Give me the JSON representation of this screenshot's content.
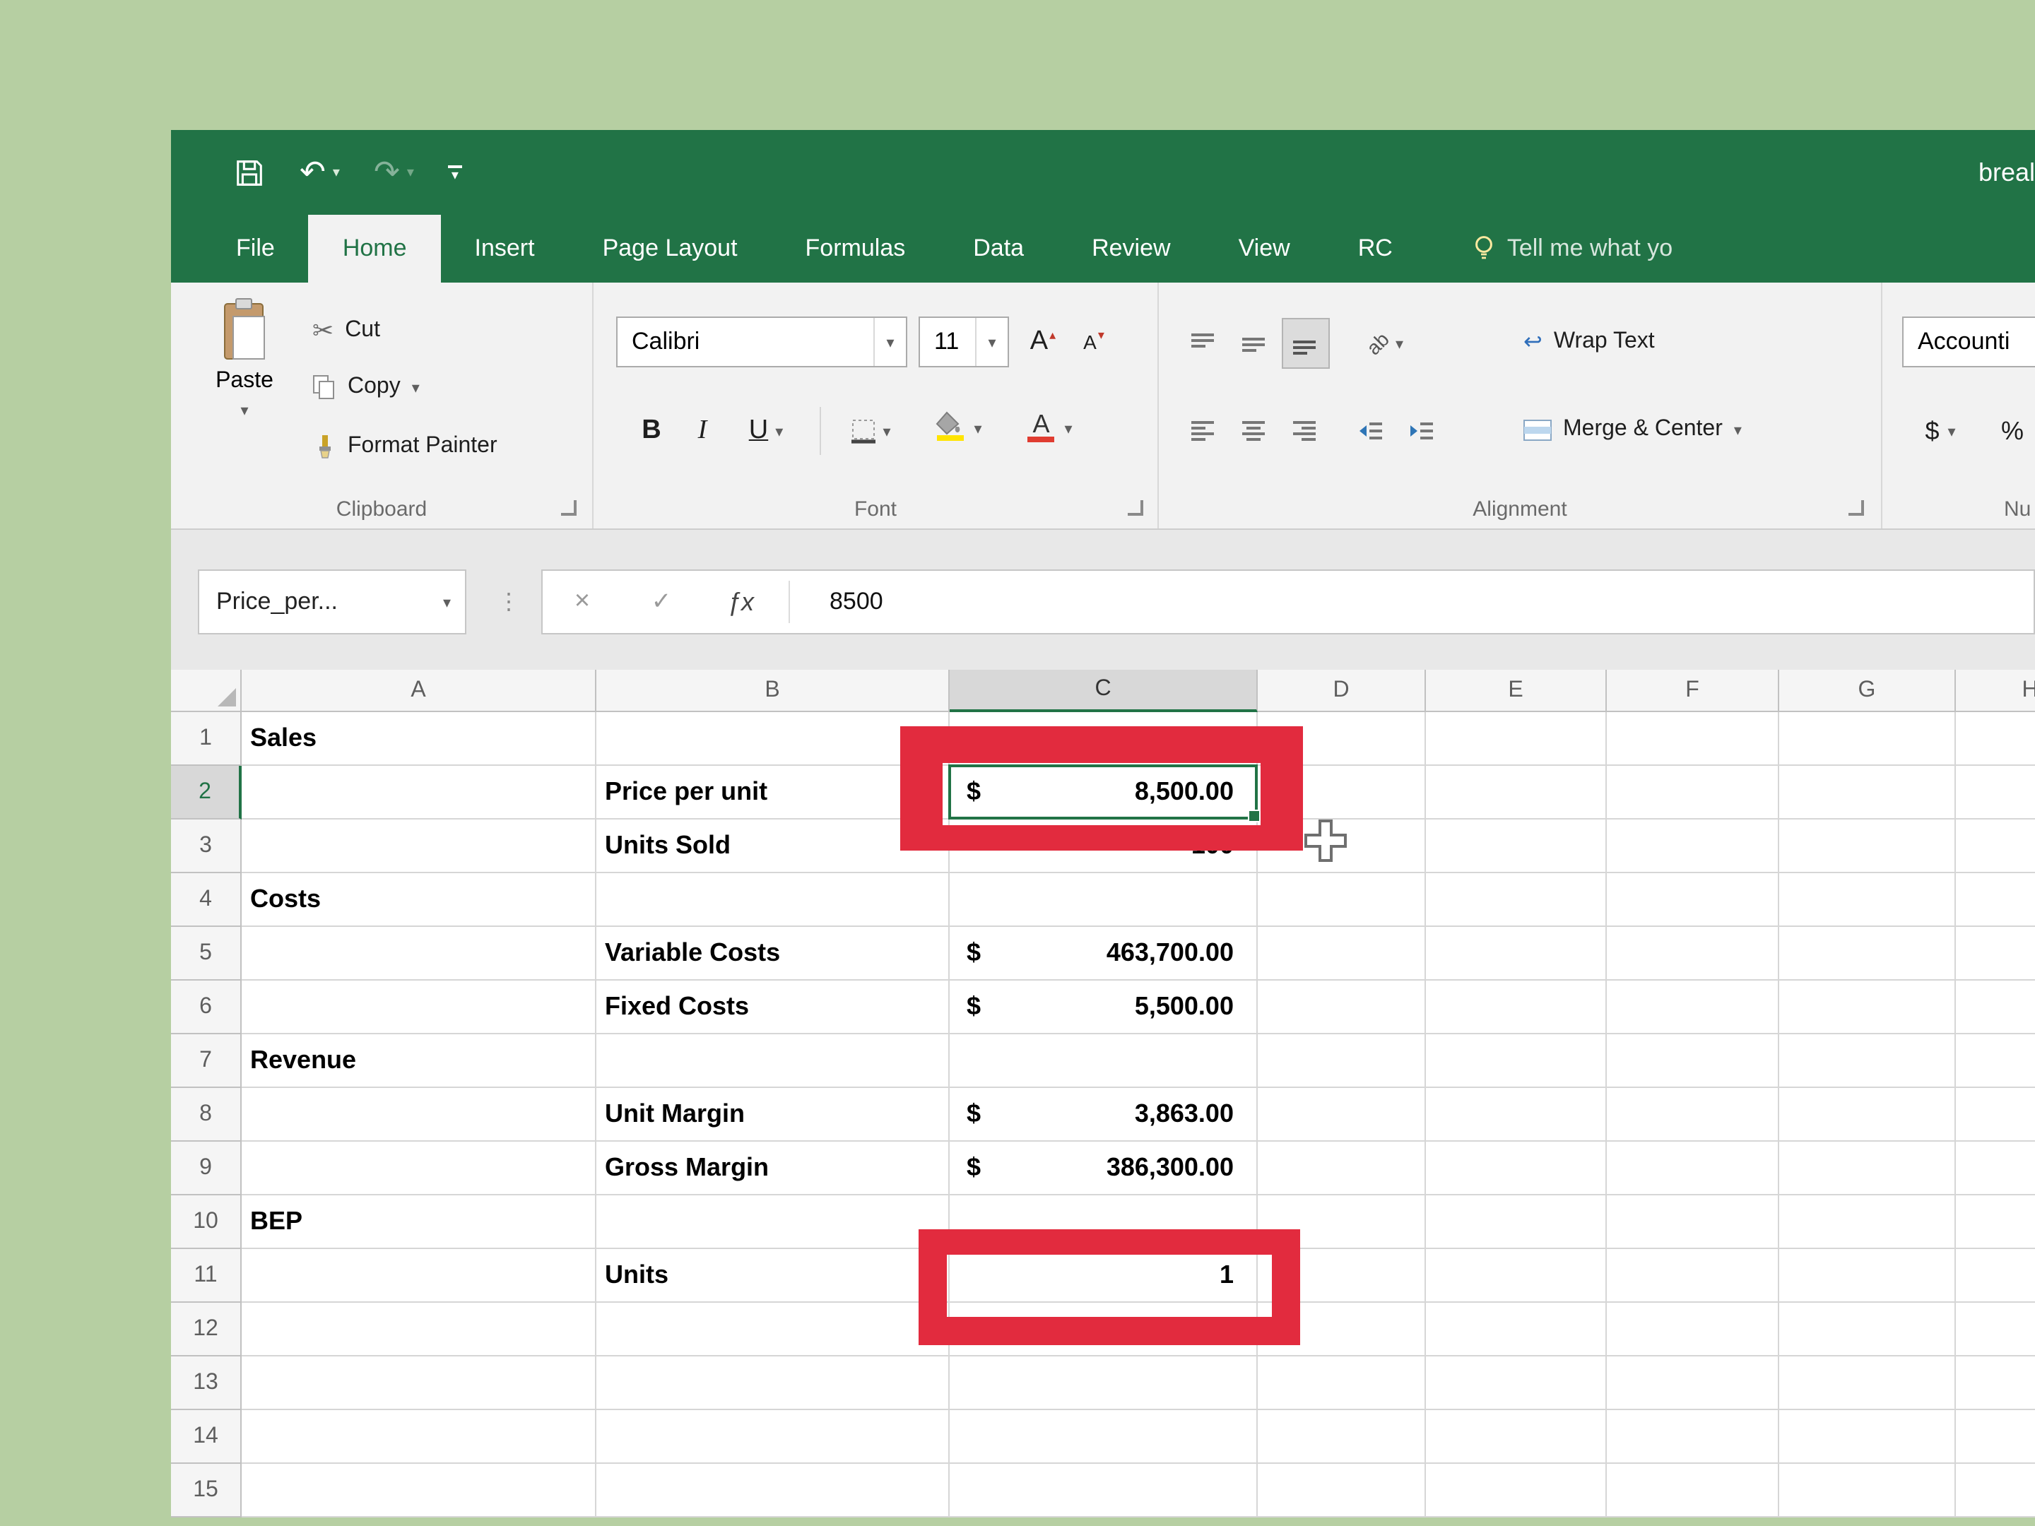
{
  "window_title": "breal",
  "tabs": [
    "File",
    "Home",
    "Insert",
    "Page Layout",
    "Formulas",
    "Data",
    "Review",
    "View",
    "RC"
  ],
  "tell_me": "Tell me what yo",
  "icons": {
    "dropdown": "▾",
    "undo": "↶",
    "redo": "↷",
    "scissors": "✂",
    "separator_dots": "⋮",
    "wrap_return": "↩",
    "increase_arrow": "▴",
    "decrease_arrow": "▾"
  },
  "ribbon": {
    "clipboard": {
      "paste": "Paste",
      "cut": "Cut",
      "copy": "Copy",
      "format_painter": "Format Painter",
      "label": "Clipboard"
    },
    "font": {
      "name": "Calibri",
      "size": "11",
      "bold": "B",
      "italic": "I",
      "underline": "U",
      "grow": "A",
      "shrink": "A",
      "color_letter": "A",
      "label": "Font"
    },
    "alignment": {
      "orientation": "ab",
      "wrap_text": "Wrap Text",
      "merge_center": "Merge & Center",
      "label": "Alignment"
    },
    "number": {
      "format": "Accounti",
      "dollar": "$",
      "percent": "%",
      "label": "Nu"
    }
  },
  "formula_bar": {
    "name_box": "Price_per...",
    "cancel": "×",
    "enter": "✓",
    "fx": "ƒx",
    "formula": "8500"
  },
  "grid": {
    "columns": [
      "A",
      "B",
      "C",
      "D",
      "E",
      "F",
      "G",
      "H"
    ],
    "rows": 15,
    "selected_cell": "C2",
    "cells": {
      "A1": {
        "t": "Sales"
      },
      "B2": {
        "t": "Price per unit"
      },
      "C2": {
        "d": "$",
        "t": "8,500.00"
      },
      "B3": {
        "t": "Units Sold"
      },
      "C3": {
        "t": "100",
        "align": "right"
      },
      "A4": {
        "t": "Costs"
      },
      "B5": {
        "t": "Variable Costs"
      },
      "C5": {
        "d": "$",
        "t": "463,700.00"
      },
      "B6": {
        "t": "Fixed Costs"
      },
      "C6": {
        "d": "$",
        "t": "5,500.00"
      },
      "A7": {
        "t": "Revenue"
      },
      "B8": {
        "t": "Unit Margin"
      },
      "C8": {
        "d": "$",
        "t": "3,863.00"
      },
      "B9": {
        "t": "Gross Margin"
      },
      "C9": {
        "d": "$",
        "t": "386,300.00"
      },
      "A10": {
        "t": "BEP"
      },
      "B11": {
        "t": "Units"
      },
      "C11": {
        "t": "1",
        "align": "right"
      }
    }
  },
  "colors": {
    "excel_green": "#217346",
    "annotation_red": "#e22b3e",
    "background_green": "#b6cfa2",
    "fill_yellow": "#ffe400",
    "font_color_red": "#e03c31"
  }
}
